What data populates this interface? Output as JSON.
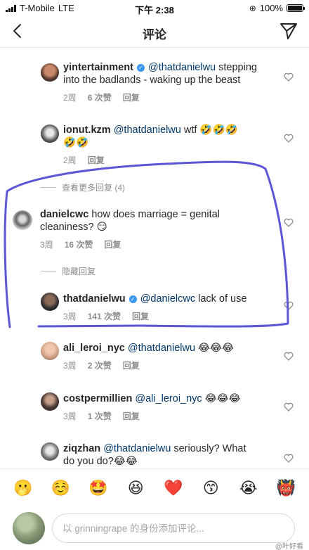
{
  "status_bar": {
    "carrier": "T-Mobile",
    "network": "LTE",
    "time": "下午 2:38",
    "battery": "100%"
  },
  "nav": {
    "title": "评论"
  },
  "comments": [
    {
      "username": "yintertainment",
      "verified": true,
      "mention": "@thatdanielwu",
      "text_line1": " stepping",
      "text_line2": "into the badlands - waking up the beast",
      "time": "2周",
      "likes": "6 次赞",
      "reply": "回复"
    },
    {
      "username": "ionut.kzm",
      "verified": false,
      "mention": "@thatdanielwu",
      "text_line1": " wtf 🤣🤣🤣",
      "text_line2": "🤣🤣",
      "time": "2周",
      "likes": "",
      "reply": "回复"
    },
    {
      "username": "danielcwc",
      "verified": false,
      "mention": "",
      "text_line1": " how does marriage = genital",
      "text_line2": "cleaniness? 😏",
      "time": "3周",
      "likes": "16 次赞",
      "reply": "回复"
    },
    {
      "username": "thatdanielwu",
      "verified": true,
      "mention": "@danielcwc",
      "text_line1": " lack of use",
      "text_line2": "",
      "time": "3周",
      "likes": "141 次赞",
      "reply": "回复"
    },
    {
      "username": "ali_leroi_nyc",
      "verified": false,
      "mention": "@thatdanielwu",
      "text_line1": " 😂😂😂",
      "text_line2": "",
      "time": "3周",
      "likes": "2 次赞",
      "reply": "回复"
    },
    {
      "username": "costpermillien",
      "verified": false,
      "mention": "@ali_leroi_nyc",
      "text_line1": " 😂😂😂",
      "text_line2": "",
      "time": "3周",
      "likes": "1 次赞",
      "reply": "回复"
    },
    {
      "username": "ziqzhan",
      "verified": false,
      "mention": "@thatdanielwu",
      "text_line1": " seriously? What",
      "text_line2": "do you do?😂😂",
      "time": "",
      "likes": "",
      "reply": ""
    }
  ],
  "thread_links": {
    "view_more": "查看更多回复 (4)",
    "hide": "隐藏回复"
  },
  "emoji_bar": [
    "🫢",
    "☺️",
    "🤩",
    "😆",
    "❤️",
    "😙",
    "😭",
    "👹"
  ],
  "input": {
    "placeholder": "以 grinningrape 的身份添加评论...",
    "watermark": "@叶好看"
  },
  "colors": {
    "annotation": "#5b56d6",
    "mention": "#00376b",
    "verified": "#3897f0"
  }
}
